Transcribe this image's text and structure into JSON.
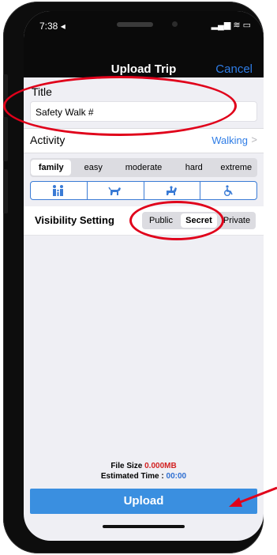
{
  "status": {
    "time": "7:38 ◂",
    "icons": "▂▄▆ ≋ ▭"
  },
  "nav": {
    "title": "Upload Trip",
    "cancel": "Cancel"
  },
  "title_section": {
    "label": "Title",
    "value": "Safety Walk #"
  },
  "activity": {
    "label": "Activity",
    "value": "Walking",
    "chevron": ">"
  },
  "difficulty": {
    "options": [
      "family",
      "easy",
      "moderate",
      "hard",
      "extreme"
    ],
    "selected": "family"
  },
  "accessibility": {
    "icons": [
      "family-icon",
      "dog-icon",
      "horse-icon",
      "wheelchair-icon"
    ]
  },
  "visibility": {
    "label": "Visibility Setting",
    "options": [
      "Public",
      "Secret",
      "Private"
    ],
    "selected": "Secret"
  },
  "file_info": {
    "size_label": "File Size",
    "size_value": "0.000MB",
    "time_label": "Estimated Time :",
    "time_value": "00:00"
  },
  "upload": {
    "label": "Upload"
  },
  "colors": {
    "accent": "#2f7de6",
    "button": "#3a8fe0",
    "annotation": "#e0001a"
  }
}
